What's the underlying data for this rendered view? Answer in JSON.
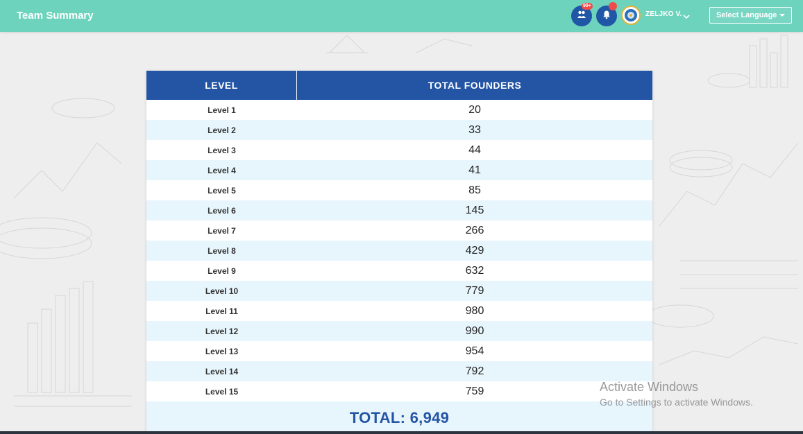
{
  "header": {
    "title": "Team Summary",
    "team_badge": "99+",
    "user_name": "ZELJKO V.",
    "language_select": "Select Language",
    "icons": [
      "team-icon",
      "bell-icon",
      "avatar",
      "chevron-down-icon"
    ]
  },
  "colors": {
    "topbar": "#6dd3bd",
    "table_header": "#2455a5",
    "row_alt": "#e7f5fd",
    "badge": "#ef4b4b"
  },
  "table": {
    "headers": [
      "LEVEL",
      "TOTAL FOUNDERS"
    ],
    "rows": [
      {
        "level": "Level 1",
        "count": "20"
      },
      {
        "level": "Level 2",
        "count": "33"
      },
      {
        "level": "Level 3",
        "count": "44"
      },
      {
        "level": "Level 4",
        "count": "41"
      },
      {
        "level": "Level 5",
        "count": "85"
      },
      {
        "level": "Level 6",
        "count": "145"
      },
      {
        "level": "Level 7",
        "count": "266"
      },
      {
        "level": "Level 8",
        "count": "429"
      },
      {
        "level": "Level 9",
        "count": "632"
      },
      {
        "level": "Level 10",
        "count": "779"
      },
      {
        "level": "Level 11",
        "count": "980"
      },
      {
        "level": "Level 12",
        "count": "990"
      },
      {
        "level": "Level 13",
        "count": "954"
      },
      {
        "level": "Level 14",
        "count": "792"
      },
      {
        "level": "Level 15",
        "count": "759"
      }
    ],
    "total": "TOTAL: 6,949"
  },
  "watermark": {
    "title": "Activate Windows",
    "subtitle": "Go to Settings to activate Windows."
  }
}
